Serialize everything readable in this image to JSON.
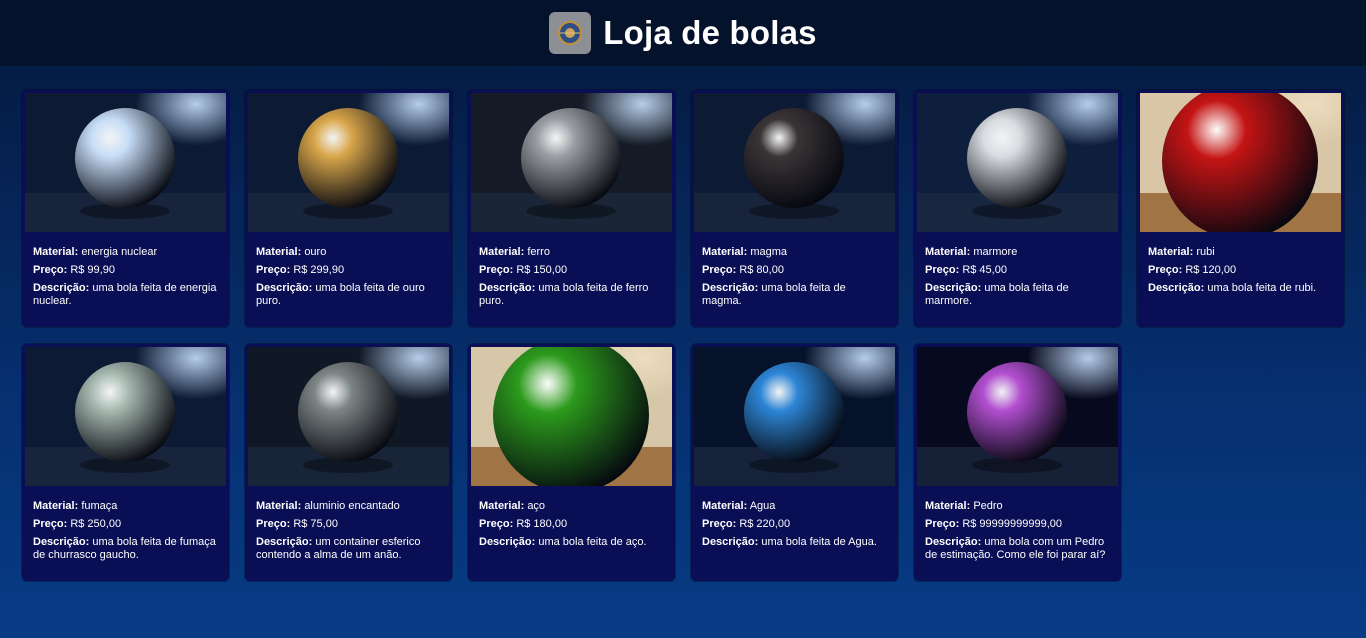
{
  "header": {
    "title": "Loja de bolas",
    "logo_icon": "ball-logo-icon"
  },
  "labels": {
    "material": "Material:",
    "price": "Preço:",
    "description": "Descrição:"
  },
  "products": [
    {
      "material": "energia nuclear",
      "price": "R$ 99,90",
      "description": "uma bola feita de energia nuclear.",
      "image": "glowing-crystal-sphere",
      "sphere": "#c7ddf7",
      "bg": "#0c1a33",
      "light": "dark"
    },
    {
      "material": "ouro",
      "price": "R$ 299,90",
      "description": "uma bola feita de ouro puro.",
      "image": "gold-sphere",
      "sphere": "#d9a64a",
      "bg": "#0c1a33",
      "light": "dark"
    },
    {
      "material": "ferro",
      "price": "R$ 150,00",
      "description": "uma bola feita de ferro puro.",
      "image": "iron-sphere",
      "sphere": "#9a9ea4",
      "bg": "#151b26",
      "light": "dark"
    },
    {
      "material": "magma",
      "price": "R$ 80,00",
      "description": "uma bola feita de magma.",
      "image": "magma-sphere",
      "sphere": "#3a3436",
      "bg": "#0c1a33",
      "light": "dark"
    },
    {
      "material": "marmore",
      "price": "R$ 45,00",
      "description": "uma bola feita de marmore.",
      "image": "marble-sphere",
      "sphere": "#d8dbe0",
      "bg": "#0e1f3d",
      "light": "dark"
    },
    {
      "material": "rubi",
      "price": "R$ 120,00",
      "description": "uma bola feita de rubi.",
      "image": "ruby-sphere",
      "sphere": "#c41414",
      "bg": "#d8c6a6",
      "light": "warm"
    },
    {
      "material": "fumaça",
      "price": "R$ 250,00",
      "description": "uma bola feita de fumaça de churrasco gaucho.",
      "image": "smoke-sphere",
      "sphere": "#a7b9b0",
      "bg": "#0c1a33",
      "light": "dark"
    },
    {
      "material": "aluminio encantado",
      "price": "R$ 75,00",
      "description": "um container esferico contendo a alma de um anão.",
      "image": "enchanted-aluminium-sphere",
      "sphere": "#7d8585",
      "bg": "#101826",
      "light": "dark"
    },
    {
      "material": "aço",
      "price": "R$ 180,00",
      "description": "uma bola feita de aço.",
      "image": "green-steel-sphere",
      "sphere": "#2c9a1c",
      "bg": "#d5c7a8",
      "light": "warm"
    },
    {
      "material": "Agua",
      "price": "R$ 220,00",
      "description": "uma bola feita de Agua.",
      "image": "water-planet-sphere",
      "sphere": "#2d86d6",
      "bg": "#06122a",
      "light": "dark"
    },
    {
      "material": "Pedro",
      "price": "R$ 99999999999,00",
      "description": "uma bola com um Pedro de estimação. Como ele foi parar aí?",
      "image": "purple-energy-sphere-with-face",
      "sphere": "#b24fd0",
      "bg": "#070a1e",
      "light": "dark"
    }
  ]
}
